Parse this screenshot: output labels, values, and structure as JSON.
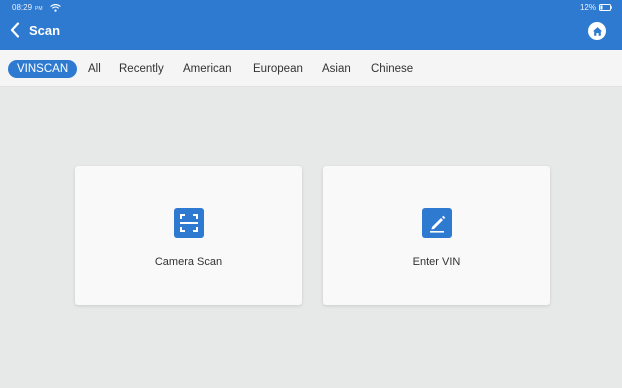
{
  "statusbar": {
    "time": "08:29",
    "ampm": "PM",
    "battery": "12%"
  },
  "header": {
    "title": "Scan",
    "back_icon": "chevron-left-icon",
    "home_icon": "home-icon"
  },
  "tabs": [
    {
      "label": "VINSCAN",
      "active": true
    },
    {
      "label": "All",
      "active": false
    },
    {
      "label": "Recently",
      "active": false
    },
    {
      "label": "American",
      "active": false
    },
    {
      "label": "European",
      "active": false
    },
    {
      "label": "Asian",
      "active": false
    },
    {
      "label": "Chinese",
      "active": false
    }
  ],
  "cards": [
    {
      "label": "Camera Scan",
      "icon": "camera-scan-icon"
    },
    {
      "label": "Enter VIN",
      "icon": "edit-pencil-icon"
    }
  ],
  "colors": {
    "accent": "#2e7ad0",
    "background": "#e7e8e8",
    "card": "#f9f9f9"
  }
}
